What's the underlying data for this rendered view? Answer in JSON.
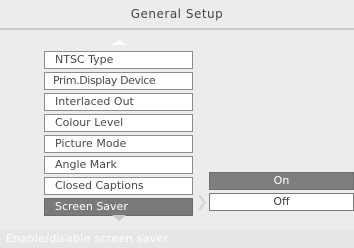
{
  "header": {
    "title": "General Setup"
  },
  "menu": {
    "items": [
      {
        "label": "NTSC Type"
      },
      {
        "label": "Prim.Display Device"
      },
      {
        "label": "Interlaced Out"
      },
      {
        "label": "Colour Level"
      },
      {
        "label": "Picture Mode"
      },
      {
        "label": "Angle Mark"
      },
      {
        "label": "Closed Captions"
      },
      {
        "label": "Screen Saver",
        "selected": true
      }
    ]
  },
  "options": {
    "items": [
      {
        "label": "On"
      },
      {
        "label": "Off"
      }
    ]
  },
  "status": {
    "text": "Enable/disable screen saver"
  },
  "icons": {
    "scroll_up": "arrow-up-icon",
    "scroll_down": "arrow-down-icon",
    "submenu": "chevron-right-icon"
  },
  "colors": {
    "background": "#ececec",
    "selected": "#7a7a7a",
    "item": "#ffffff"
  }
}
